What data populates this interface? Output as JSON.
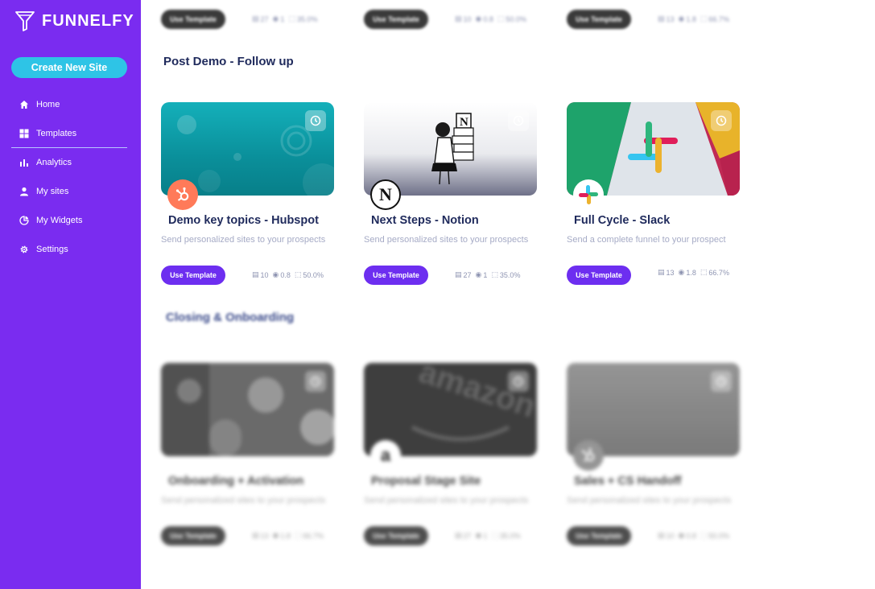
{
  "brand": {
    "name": "FUNNELFY"
  },
  "sidebar": {
    "create_button": "Create New Site",
    "items": [
      {
        "label": "Home",
        "icon": "home-icon"
      },
      {
        "label": "Templates",
        "icon": "grid-icon",
        "active": true
      },
      {
        "label": "Analytics",
        "icon": "bar-chart-icon"
      },
      {
        "label": "My sites",
        "icon": "user-icon"
      },
      {
        "label": "My Widgets",
        "icon": "widget-icon"
      },
      {
        "label": "Settings",
        "icon": "gear-icon"
      }
    ]
  },
  "top_row": [
    {
      "button": "Use Template",
      "stats": [
        "27",
        "1",
        "35.0%"
      ]
    },
    {
      "button": "Use Template",
      "stats": [
        "10",
        "0.8",
        "50.0%"
      ]
    },
    {
      "button": "Use Template",
      "stats": [
        "13",
        "1.8",
        "66.7%"
      ]
    }
  ],
  "sections": [
    {
      "title": "Post Demo - Follow up",
      "cards": [
        {
          "title": "Demo key topics - Hubspot",
          "description": "Send personalized sites to your prospects",
          "button": "Use Template",
          "stats": [
            "10",
            "0.8",
            "50.0%"
          ],
          "logo": "hubspot-logo"
        },
        {
          "title": "Next Steps - Notion",
          "description": "Send personalized sites to your prospects",
          "button": "Use Template",
          "stats": [
            "27",
            "1",
            "35.0%"
          ],
          "logo": "notion-logo"
        },
        {
          "title": "Full Cycle - Slack",
          "description": "Send a complete funnel to your prospect",
          "button": "Use Template",
          "stats": [
            "13",
            "1.8",
            "66.7%"
          ],
          "logo": "slack-logo"
        }
      ]
    },
    {
      "title": "Closing & Onboarding",
      "cards": [
        {
          "title": "Onboarding + Activation",
          "description": "Send personalized sites to your prospects",
          "button": "Use Template",
          "stats": [
            "13",
            "1.8",
            "66.7%"
          ],
          "logo": "figma-logo"
        },
        {
          "title": "Proposal Stage Site",
          "description": "Send personalized sites to your prospects",
          "button": "Use Template",
          "stats": [
            "27",
            "1",
            "35.0%"
          ],
          "logo": "amazon-logo"
        },
        {
          "title": "Sales + CS Handoff",
          "description": "Send personalized sites to your prospects",
          "button": "Use Template",
          "stats": [
            "10",
            "0.8",
            "50.0%"
          ],
          "logo": "hubspot-logo"
        }
      ]
    }
  ],
  "colors": {
    "sidebar": "#7a2cf0",
    "accent": "#2ec4e6",
    "button": "#6d2ef0",
    "title": "#1f2a5c"
  }
}
